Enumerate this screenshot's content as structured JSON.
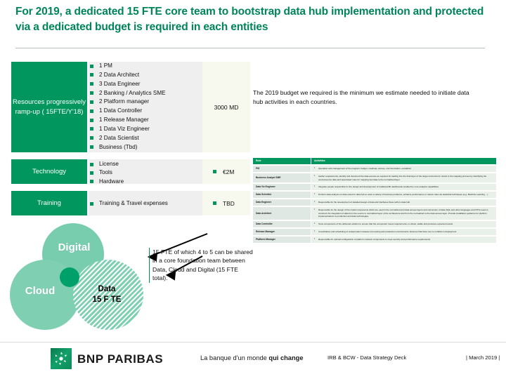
{
  "slide": {
    "title": "For 2019, a dedicated 15 FTE core team to bootstrap data hub implementation and protected via a dedicated budget is required in each entities",
    "accent_color": "#00965e",
    "title_color": "#00855a"
  },
  "categories": [
    {
      "label": "Resources progressively ramp-up ( 15FTE/Y'18)",
      "value": "3000 MD"
    },
    {
      "label": "Technology",
      "value": "€2M"
    },
    {
      "label": "Training",
      "value": "TBD"
    }
  ],
  "resources_items": [
    "1 PM",
    "2 Data Architect",
    "3 Data Engineer",
    "2 Banking / Analytics SME",
    "2 Platform manager",
    "1 Data Controller",
    "1 Release Manager",
    "1 Data Viz Engineer",
    "2 Data Scientist",
    "Business (Tbd)"
  ],
  "technology_items": [
    "License",
    "Tools",
    "Hardware"
  ],
  "training_items": [
    "Training & Travel expenses"
  ],
  "note": "The 2019 budget we required is the minimum we estimate needed to initiate data hub activities in each countries.",
  "venn": {
    "digital": "Digital",
    "cloud": "Cloud",
    "data": "Data",
    "data_fte": "15 F TE"
  },
  "callout": "15 FTE of which 4 to 5 can be shared in a core foundation team between Data, Cloud and Digital (15 FTE total).",
  "role_table": {
    "headers": [
      "Role",
      "Activities"
    ],
    "rows": [
      {
        "role": "PM",
        "activity": "Operation and management of the program: budget, roadmap, access, communication, escalation"
      },
      {
        "role": "Business Analyst SME",
        "activity": "Gather requirements, identify and document the data sources as required for loading into the final layer of the target environment. Assist in the mapping process by identifying the source/source data and associated rules for mapping raw data to the normalized layer."
      },
      {
        "role": "Data Viz Engineer",
        "activity": "Integrate people responsible for the design and development of traditional BI dashboards enabled by core analytics capabilities"
      },
      {
        "role": "Data Scientist",
        "activity": "Perform data analysis on data stored in data hub to solve a variety of business problems, enhance performance or reduce risks via statistical techniques (e.g. Machine Learning ...)"
      },
      {
        "role": "Data Engineer",
        "activity": "Responsible for the development of detailed design of data and interfaces flows to/from data hub"
      },
      {
        "role": "Data Architect",
        "activity": "Responsible for the design of the model components which are used in the normalized and data access layers and conversion of data (SQL and other languages and DTS) used to construct the integration of data from the source to normalized layer of the architecture and from the normalized to the data access layer. Provide installation guidance for platform implementations to production and data technologies"
      },
      {
        "role": "Data Controller",
        "activity": "Tests components of the delivered solution to ensure that the component meets requirements, is robust, stable and produces expected results"
      },
      {
        "role": "Release Manager",
        "activity": "Coordination and scheduling of code/product releases into testing and production environments. Ensures that there are no conflicts in deployment"
      },
      {
        "role": "Platform Manager",
        "activity": "Responsible for optimal configuration of platform network components to meet security and performance requirements"
      }
    ]
  },
  "footer": {
    "brand": "BNP PARIBAS",
    "tagline_part1": "La banque d'un monde ",
    "tagline_part2": "qui change",
    "deck": "IRB & BCW - Data Strategy Deck",
    "date": "| March 2019 |"
  }
}
